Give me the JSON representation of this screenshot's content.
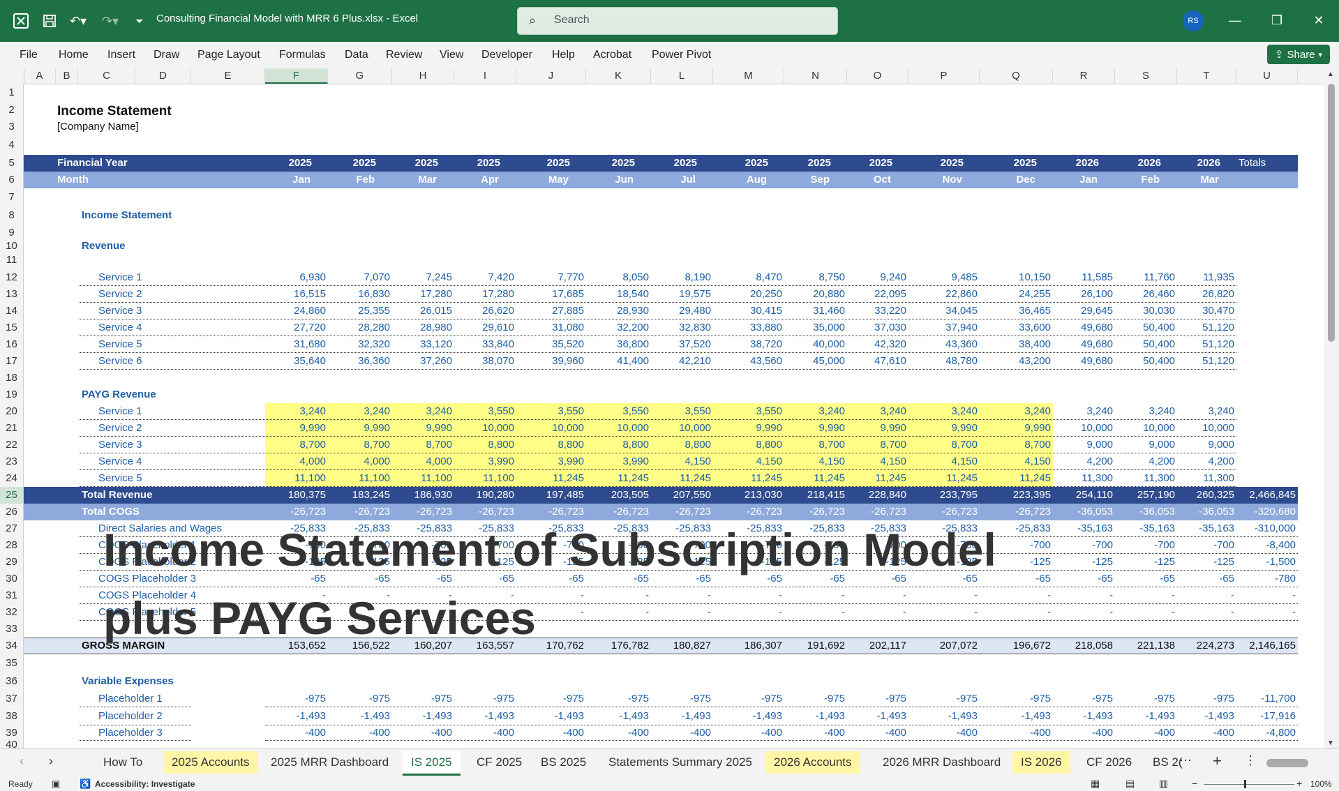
{
  "window": {
    "title": "Consulting Financial Model with MRR 6 Plus.xlsx  -  Excel",
    "search_placeholder": "Search",
    "user_initials": "RS"
  },
  "ribbon": {
    "tabs": [
      "File",
      "Home",
      "Insert",
      "Draw",
      "Page Layout",
      "Formulas",
      "Data",
      "Review",
      "View",
      "Developer",
      "Help",
      "Acrobat",
      "Power Pivot"
    ],
    "share_label": "Share"
  },
  "columns": [
    "A",
    "B",
    "C",
    "D",
    "E",
    "F",
    "G",
    "H",
    "I",
    "J",
    "K",
    "L",
    "M",
    "N",
    "O",
    "P",
    "Q",
    "R",
    "S",
    "T",
    "U"
  ],
  "selected_column": "F",
  "rows": [
    "1",
    "2",
    "3",
    "4",
    "5",
    "6",
    "7",
    "8",
    "9",
    "10",
    "11",
    "12",
    "13",
    "14",
    "15",
    "16",
    "17",
    "18",
    "19",
    "20",
    "21",
    "22",
    "23",
    "24",
    "25",
    "26",
    "27",
    "28",
    "29",
    "30",
    "31",
    "32",
    "33",
    "34",
    "35",
    "36",
    "37",
    "38",
    "39",
    "40"
  ],
  "sheet": {
    "title": "Income Statement",
    "company": "[Company Name]",
    "financial_year_label": "Financial Year",
    "month_label": "Month",
    "years": [
      "2025",
      "2025",
      "2025",
      "2025",
      "2025",
      "2025",
      "2025",
      "2025",
      "2025",
      "2025",
      "2025",
      "2025",
      "2026",
      "2026",
      "2026"
    ],
    "months": [
      "Jan",
      "Feb",
      "Mar",
      "Apr",
      "May",
      "Jun",
      "Jul",
      "Aug",
      "Sep",
      "Oct",
      "Nov",
      "Dec",
      "Jan",
      "Feb",
      "Mar"
    ],
    "totals_label": "Totals",
    "section_income": "Income Statement",
    "section_revenue": "Revenue",
    "revenue_rows": [
      {
        "label": "Service 1",
        "values": [
          "6,930",
          "7,070",
          "7,245",
          "7,420",
          "7,770",
          "8,050",
          "8,190",
          "8,470",
          "8,750",
          "9,240",
          "9,485",
          "10,150",
          "11,585",
          "11,760",
          "11,935"
        ]
      },
      {
        "label": "Service 2",
        "values": [
          "16,515",
          "16,830",
          "17,280",
          "17,280",
          "17,685",
          "18,540",
          "19,575",
          "20,250",
          "20,880",
          "22,095",
          "22,860",
          "24,255",
          "26,100",
          "26,460",
          "26,820"
        ]
      },
      {
        "label": "Service 3",
        "values": [
          "24,860",
          "25,355",
          "26,015",
          "26,620",
          "27,885",
          "28,930",
          "29,480",
          "30,415",
          "31,460",
          "33,220",
          "34,045",
          "36,465",
          "29,645",
          "30,030",
          "30,470"
        ]
      },
      {
        "label": "Service 4",
        "values": [
          "27,720",
          "28,280",
          "28,980",
          "29,610",
          "31,080",
          "32,200",
          "32,830",
          "33,880",
          "35,000",
          "37,030",
          "37,940",
          "33,600",
          "49,680",
          "50,400",
          "51,120"
        ]
      },
      {
        "label": "Service 5",
        "values": [
          "31,680",
          "32,320",
          "33,120",
          "33,840",
          "35,520",
          "36,800",
          "37,520",
          "38,720",
          "40,000",
          "42,320",
          "43,360",
          "38,400",
          "49,680",
          "50,400",
          "51,120"
        ]
      },
      {
        "label": "Service 6",
        "values": [
          "35,640",
          "36,360",
          "37,260",
          "38,070",
          "39,960",
          "41,400",
          "42,210",
          "43,560",
          "45,000",
          "47,610",
          "48,780",
          "43,200",
          "49,680",
          "50,400",
          "51,120"
        ]
      }
    ],
    "section_payg": "PAYG Revenue",
    "payg_rows": [
      {
        "label": "Service 1",
        "values": [
          "3,240",
          "3,240",
          "3,240",
          "3,550",
          "3,550",
          "3,550",
          "3,550",
          "3,550",
          "3,240",
          "3,240",
          "3,240",
          "3,240",
          "3,240",
          "3,240",
          "3,240"
        ]
      },
      {
        "label": "Service 2",
        "values": [
          "9,990",
          "9,990",
          "9,990",
          "10,000",
          "10,000",
          "10,000",
          "10,000",
          "9,990",
          "9,990",
          "9,990",
          "9,990",
          "9,990",
          "10,000",
          "10,000",
          "10,000"
        ]
      },
      {
        "label": "Service 3",
        "values": [
          "8,700",
          "8,700",
          "8,700",
          "8,800",
          "8,800",
          "8,800",
          "8,800",
          "8,800",
          "8,700",
          "8,700",
          "8,700",
          "8,700",
          "9,000",
          "9,000",
          "9,000"
        ]
      },
      {
        "label": "Service 4",
        "values": [
          "4,000",
          "4,000",
          "4,000",
          "3,990",
          "3,990",
          "3,990",
          "4,150",
          "4,150",
          "4,150",
          "4,150",
          "4,150",
          "4,150",
          "4,200",
          "4,200",
          "4,200"
        ]
      },
      {
        "label": "Service 5",
        "values": [
          "11,100",
          "11,100",
          "11,100",
          "11,100",
          "11,245",
          "11,245",
          "11,245",
          "11,245",
          "11,245",
          "11,245",
          "11,245",
          "11,245",
          "11,300",
          "11,300",
          "11,300"
        ]
      }
    ],
    "total_revenue": {
      "label": "Total Revenue",
      "values": [
        "180,375",
        "183,245",
        "186,930",
        "190,280",
        "197,485",
        "203,505",
        "207,550",
        "213,030",
        "218,415",
        "228,840",
        "233,795",
        "223,395",
        "254,110",
        "257,190",
        "260,325"
      ],
      "total": "2,466,845"
    },
    "total_cogs": {
      "label": "Total COGS",
      "values": [
        "-26,723",
        "-26,723",
        "-26,723",
        "-26,723",
        "-26,723",
        "-26,723",
        "-26,723",
        "-26,723",
        "-26,723",
        "-26,723",
        "-26,723",
        "-26,723",
        "-36,053",
        "-36,053",
        "-36,053"
      ],
      "total": "-320,680"
    },
    "cogs_rows": [
      {
        "label": "Direct Salaries and Wages",
        "values": [
          "-25,833",
          "-25,833",
          "-25,833",
          "-25,833",
          "-25,833",
          "-25,833",
          "-25,833",
          "-25,833",
          "-25,833",
          "-25,833",
          "-25,833",
          "-25,833",
          "-35,163",
          "-35,163",
          "-35,163"
        ],
        "total": "-310,000"
      },
      {
        "label": "COGS Placeholder 1",
        "values": [
          "-700",
          "-700",
          "-700",
          "-700",
          "-700",
          "-700",
          "-700",
          "-700",
          "-700",
          "-700",
          "-700",
          "-700",
          "-700",
          "-700",
          "-700"
        ],
        "total": "-8,400"
      },
      {
        "label": "COGS Placeholder 2",
        "values": [
          "-125",
          "-125",
          "-125",
          "-125",
          "-125",
          "-125",
          "-125",
          "-125",
          "-125",
          "-125",
          "-125",
          "-125",
          "-125",
          "-125",
          "-125"
        ],
        "total": "-1,500"
      },
      {
        "label": "COGS Placeholder 3",
        "values": [
          "-65",
          "-65",
          "-65",
          "-65",
          "-65",
          "-65",
          "-65",
          "-65",
          "-65",
          "-65",
          "-65",
          "-65",
          "-65",
          "-65",
          "-65"
        ],
        "total": "-780"
      },
      {
        "label": "COGS Placeholder 4",
        "values": [
          "-",
          "-",
          "-",
          "-",
          "-",
          "-",
          "-",
          "-",
          "-",
          "-",
          "-",
          "-",
          "-",
          "-",
          "-"
        ],
        "total": "-"
      },
      {
        "label": "COGS Placeholder 5",
        "values": [
          "-",
          "-",
          "-",
          "-",
          "-",
          "-",
          "-",
          "-",
          "-",
          "-",
          "-",
          "-",
          "-",
          "-",
          "-"
        ],
        "total": "-"
      }
    ],
    "gross_margin": {
      "label": "GROSS MARGIN",
      "values": [
        "153,652",
        "156,522",
        "160,207",
        "163,557",
        "170,762",
        "176,782",
        "180,827",
        "186,307",
        "191,692",
        "202,117",
        "207,072",
        "196,672",
        "218,058",
        "221,138",
        "224,273"
      ],
      "total": "2,146,165"
    },
    "section_variable": "Variable Expenses",
    "variable_rows": [
      {
        "label": "Placeholder 1",
        "values": [
          "-975",
          "-975",
          "-975",
          "-975",
          "-975",
          "-975",
          "-975",
          "-975",
          "-975",
          "-975",
          "-975",
          "-975",
          "-975",
          "-975",
          "-975"
        ],
        "total": "-11,700"
      },
      {
        "label": "Placeholder 2",
        "values": [
          "-1,493",
          "-1,493",
          "-1,493",
          "-1,493",
          "-1,493",
          "-1,493",
          "-1,493",
          "-1,493",
          "-1,493",
          "-1,493",
          "-1,493",
          "-1,493",
          "-1,493",
          "-1,493",
          "-1,493"
        ],
        "total": "-17,916"
      },
      {
        "label": "Placeholder 3",
        "values": [
          "-400",
          "-400",
          "-400",
          "-400",
          "-400",
          "-400",
          "-400",
          "-400",
          "-400",
          "-400",
          "-400",
          "-400",
          "-400",
          "-400",
          "-400"
        ],
        "total": "-4,800"
      }
    ]
  },
  "overlay_text": {
    "line1": "Income Statement of Subscription Model",
    "line2": "plus PAYG Services"
  },
  "sheet_tabs": [
    {
      "label": "How To",
      "style": "plain"
    },
    {
      "label": "2025 Accounts",
      "style": "yellow"
    },
    {
      "label": "2025 MRR Dashboard",
      "style": "plain"
    },
    {
      "label": "IS 2025",
      "style": "active"
    },
    {
      "label": "CF 2025",
      "style": "plain"
    },
    {
      "label": "BS 2025",
      "style": "plain"
    },
    {
      "label": "Statements Summary 2025",
      "style": "plain"
    },
    {
      "label": "2026 Accounts",
      "style": "yellow"
    },
    {
      "label": "2026 MRR Dashboard",
      "style": "plain"
    },
    {
      "label": "IS 2026",
      "style": "yellow"
    },
    {
      "label": "CF 2026",
      "style": "plain"
    },
    {
      "label": "BS 2(",
      "style": "plain"
    }
  ],
  "status": {
    "ready": "Ready",
    "accessibility": "Accessibility: Investigate",
    "zoom": "100%"
  },
  "colors": {
    "excel_green": "#1e7145",
    "header_navy": "#2f4b8f",
    "header_light": "#8ea9db",
    "label_blue": "#1f5fa6",
    "payg_yellow": "#ffff88"
  }
}
